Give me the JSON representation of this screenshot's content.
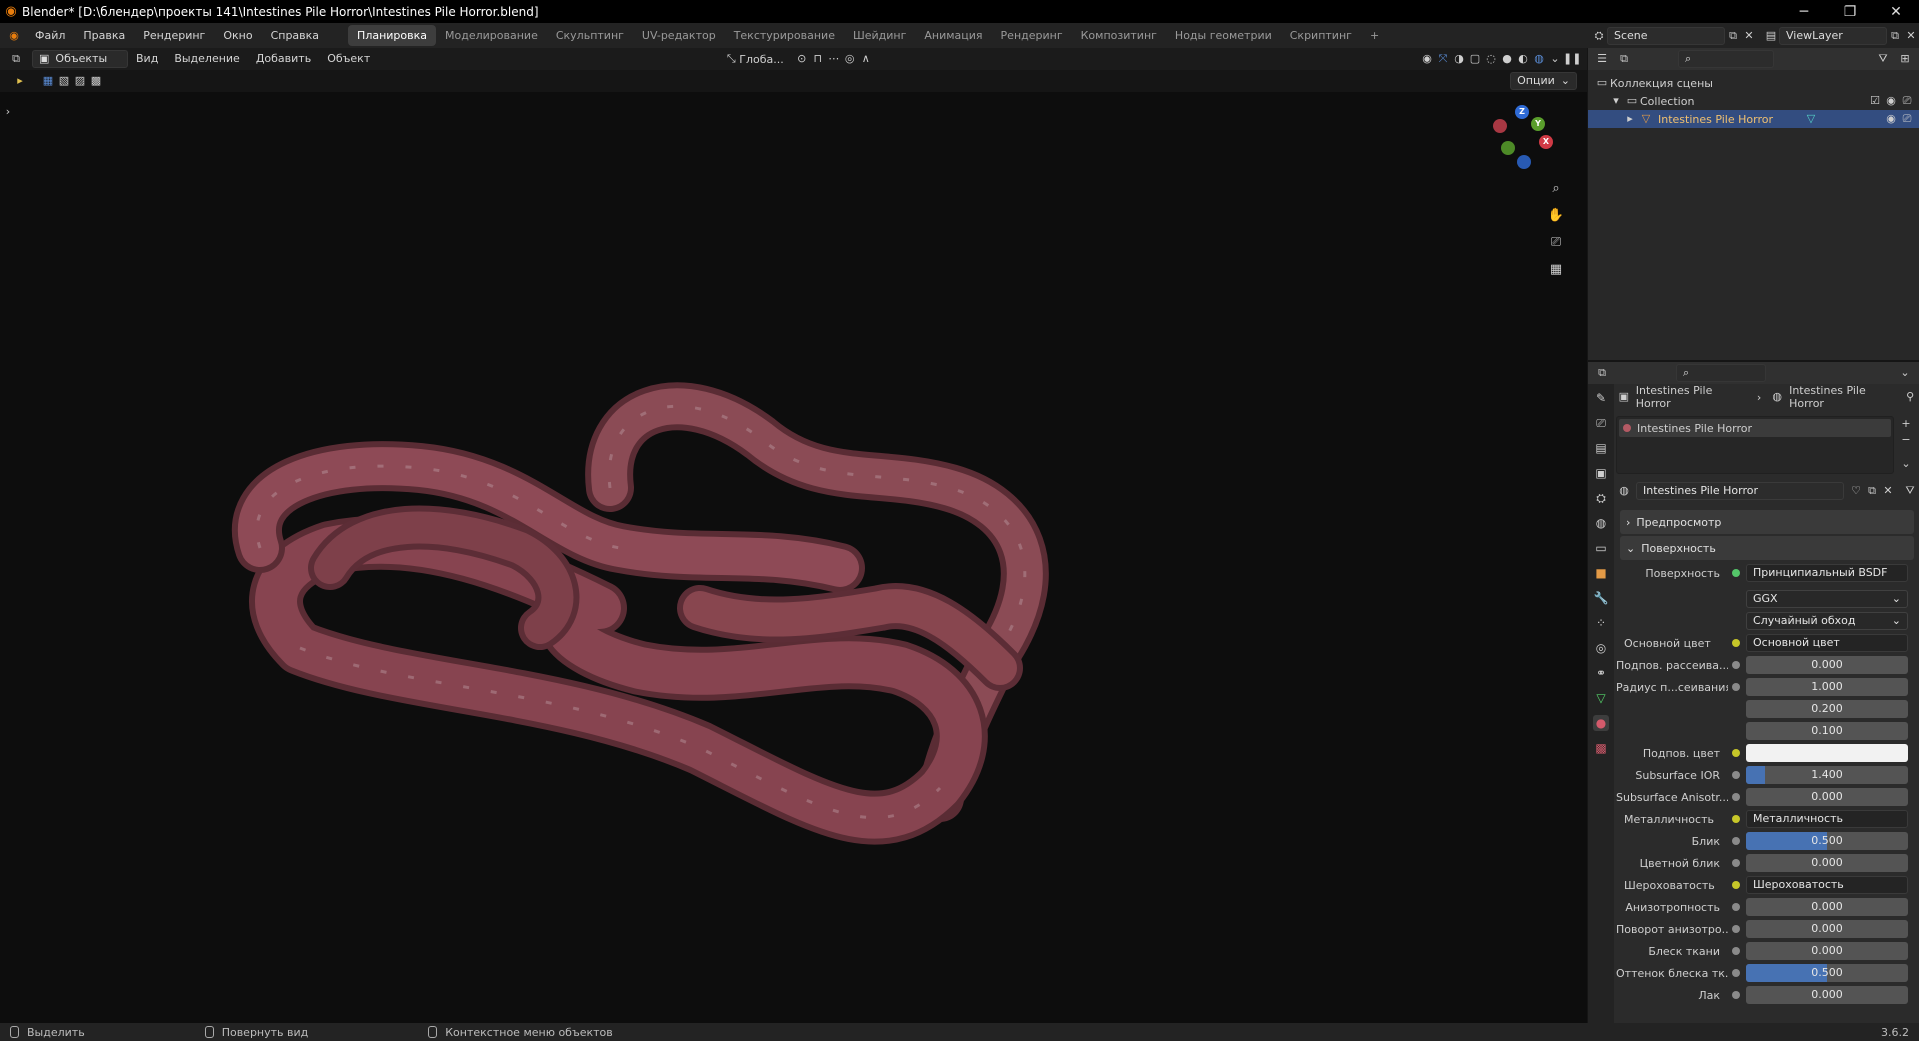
{
  "window": {
    "title": "Blender* [D:\\блендер\\проекты 141\\Intestines Pile Horror\\Intestines Pile Horror.blend]",
    "minimize": "─",
    "maximize": "❐",
    "close": "✕"
  },
  "menu": [
    "Файл",
    "Правка",
    "Рендеринг",
    "Окно",
    "Справка"
  ],
  "workspaces": [
    "Планировка",
    "Моделирование",
    "Скульптинг",
    "UV-редактор",
    "Текстурирование",
    "Шейдинг",
    "Анимация",
    "Рендеринг",
    "Композитинг",
    "Ноды геометрии",
    "Скриптинг"
  ],
  "workspace_add": "+",
  "scene": {
    "name": "Scene",
    "view_layer": "ViewLayer"
  },
  "viewport": {
    "mode": "Объекты",
    "menus": [
      "Вид",
      "Выделение",
      "Добавить",
      "Объект"
    ],
    "transform": "Глоба...",
    "options": "Опции",
    "axes": {
      "x": "X",
      "y": "Y",
      "z": "Z"
    }
  },
  "outliner": {
    "scene_collection": "Коллекция сцены",
    "collection": "Collection",
    "object": "Intestines Pile Horror"
  },
  "properties": {
    "breadcrumb": [
      "Intestines Pile Horror",
      "Intestines Pile Horror"
    ],
    "material_slot": "Intestines Pile Horror",
    "material_name": "Intestines Pile Horror",
    "panels": {
      "preview": "Предпросмотр",
      "surface": "Поверхность"
    },
    "surface_label": "Поверхность",
    "surface_value": "Принципиальный BSDF",
    "distribution": "GGX",
    "subsurface_method": "Случайный обход",
    "rows": [
      {
        "label": "Основной цвет",
        "type": "link",
        "value": "Основной цвет"
      },
      {
        "label": "Подпов. рассеива...",
        "type": "num",
        "value": "0.000",
        "fill": 0
      },
      {
        "label": "Радиус п...сеивания",
        "type": "num",
        "value": "1.000",
        "fill": 0
      },
      {
        "label": "",
        "type": "num",
        "value": "0.200",
        "fill": 0
      },
      {
        "label": "",
        "type": "num",
        "value": "0.100",
        "fill": 0
      },
      {
        "label": "Подпов. цвет",
        "type": "color",
        "value": ""
      },
      {
        "label": "Subsurface IOR",
        "type": "num",
        "value": "1.400",
        "fill": 0.12
      },
      {
        "label": "Subsurface Anisotr...",
        "type": "num",
        "value": "0.000",
        "fill": 0
      },
      {
        "label": "Металличность",
        "type": "link",
        "value": "Металличность"
      },
      {
        "label": "Блик",
        "type": "num",
        "value": "0.500",
        "fill": 0.5
      },
      {
        "label": "Цветной блик",
        "type": "num",
        "value": "0.000",
        "fill": 0
      },
      {
        "label": "Шероховатость",
        "type": "link",
        "value": "Шероховатость"
      },
      {
        "label": "Анизотропность",
        "type": "num",
        "value": "0.000",
        "fill": 0
      },
      {
        "label": "Поворот анизотро...",
        "type": "num",
        "value": "0.000",
        "fill": 0
      },
      {
        "label": "Блеск ткани",
        "type": "num",
        "value": "0.000",
        "fill": 0
      },
      {
        "label": "Оттенок блеска тк...",
        "type": "num",
        "value": "0.500",
        "fill": 0.5
      },
      {
        "label": "Лак",
        "type": "num",
        "value": "0.000",
        "fill": 0
      }
    ]
  },
  "status": {
    "select": "Выделить",
    "rotate": "Повернуть вид",
    "context": "Контекстное меню объектов",
    "version": "3.6.2"
  },
  "colors": {
    "accent": "#4772b3",
    "selection": "#334d80",
    "intestine": "#7a3f48"
  }
}
